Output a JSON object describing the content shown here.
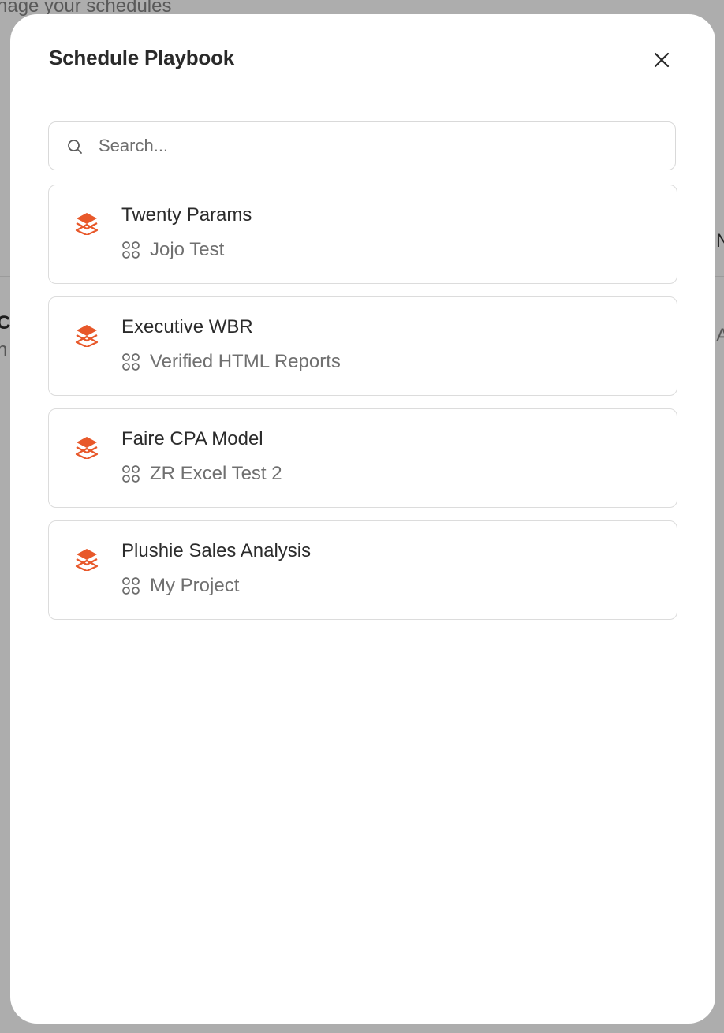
{
  "background": {
    "subtitle": "nage your schedules",
    "fragments": [
      "CF",
      "n",
      "N",
      "A"
    ]
  },
  "modal": {
    "title": "Schedule Playbook",
    "close_icon": "close-icon",
    "search": {
      "placeholder": "Search...",
      "value": "",
      "icon": "search-icon"
    },
    "items": [
      {
        "title": "Twenty Params",
        "project": "Jojo Test",
        "icon": "layers-icon",
        "project_icon": "grid-icon"
      },
      {
        "title": "Executive WBR",
        "project": "Verified HTML Reports",
        "icon": "layers-icon",
        "project_icon": "grid-icon"
      },
      {
        "title": "Faire CPA Model",
        "project": "ZR Excel Test 2",
        "icon": "layers-icon",
        "project_icon": "grid-icon"
      },
      {
        "title": "Plushie Sales Analysis",
        "project": "My Project",
        "icon": "layers-icon",
        "project_icon": "grid-icon"
      }
    ]
  },
  "colors": {
    "accent": "#e8582a",
    "overlay": "#adadad",
    "text_primary": "#2b2b2b",
    "text_secondary": "#707070",
    "border": "#dcdcdc"
  }
}
